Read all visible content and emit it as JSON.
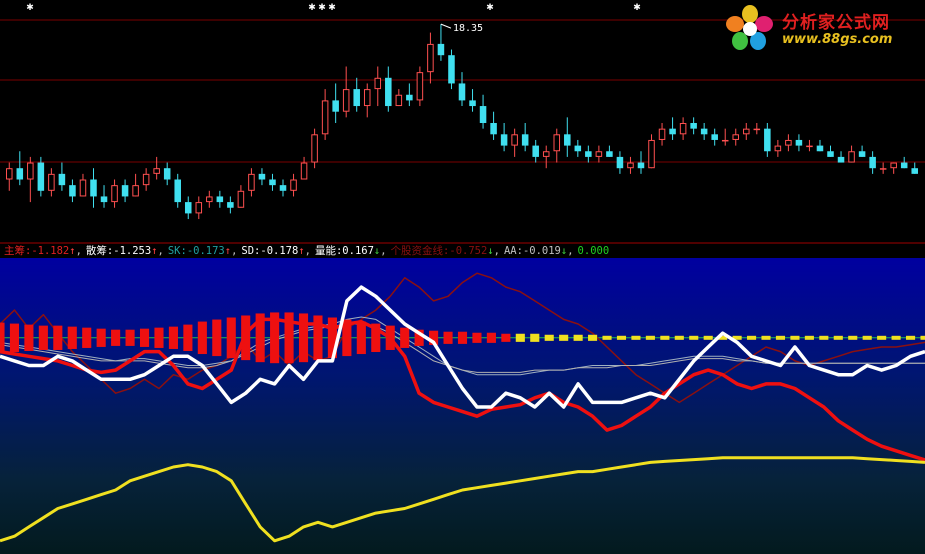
{
  "logo": {
    "title": "分析家公式网",
    "url": "www.88gs.com"
  },
  "indicator_legend": [
    {
      "label": "主筹:",
      "value": "-1.182",
      "arrow": "↑",
      "color": "#e02020"
    },
    {
      "label": "散筹:",
      "value": "-1.253",
      "arrow": "↑",
      "color": "#ffffff"
    },
    {
      "label": "SK:",
      "value": "-0.173",
      "arrow": "↑",
      "color": "#20a0a0"
    },
    {
      "label": "SD:",
      "value": "-0.178",
      "arrow": "↑",
      "color": "#ffffff"
    },
    {
      "label": "量能:",
      "value": "0.167",
      "arrow": "↓",
      "color": "#ffffff"
    },
    {
      "label": "个股资金线:",
      "value": "-0.752",
      "arrow": "↓",
      "color": "#8b1010"
    },
    {
      "label": "AA:",
      "value": "-0.019",
      "arrow": "↓",
      "color": "#c0c0c0"
    },
    {
      "label": "",
      "value": "0.000",
      "arrow": "",
      "color": "#20d020"
    }
  ],
  "colors": {
    "up": "#ff5050",
    "down": "#40e0f0",
    "white": "#ffffff",
    "red": "#ee1010",
    "darkred": "#8b1010",
    "yellow": "#f0e020",
    "sk": "#a0b0c0",
    "sd": "#b0b0b0",
    "zero": "#20c040"
  },
  "chart_data": [
    {
      "type": "candlestick",
      "high_label": "18.35",
      "ohlc": [
        [
          15.6,
          15.9,
          15.4,
          15.8
        ],
        [
          15.8,
          16.1,
          15.5,
          15.6
        ],
        [
          15.6,
          16.0,
          15.2,
          15.9
        ],
        [
          15.9,
          16.0,
          15.3,
          15.4
        ],
        [
          15.4,
          15.8,
          15.3,
          15.7
        ],
        [
          15.7,
          15.9,
          15.4,
          15.5
        ],
        [
          15.5,
          15.6,
          15.2,
          15.3
        ],
        [
          15.3,
          15.7,
          15.3,
          15.6
        ],
        [
          15.6,
          15.8,
          15.1,
          15.3
        ],
        [
          15.3,
          15.5,
          15.1,
          15.2
        ],
        [
          15.2,
          15.6,
          15.1,
          15.5
        ],
        [
          15.5,
          15.6,
          15.2,
          15.3
        ],
        [
          15.3,
          15.7,
          15.3,
          15.5
        ],
        [
          15.5,
          15.8,
          15.4,
          15.7
        ],
        [
          15.7,
          16.0,
          15.6,
          15.8
        ],
        [
          15.8,
          15.9,
          15.5,
          15.6
        ],
        [
          15.6,
          15.7,
          15.1,
          15.2
        ],
        [
          15.2,
          15.3,
          14.9,
          15.0
        ],
        [
          15.0,
          15.3,
          14.9,
          15.2
        ],
        [
          15.2,
          15.4,
          15.1,
          15.3
        ],
        [
          15.3,
          15.4,
          15.1,
          15.2
        ],
        [
          15.2,
          15.3,
          15.0,
          15.1
        ],
        [
          15.1,
          15.5,
          15.1,
          15.4
        ],
        [
          15.4,
          15.8,
          15.3,
          15.7
        ],
        [
          15.7,
          15.8,
          15.5,
          15.6
        ],
        [
          15.6,
          15.7,
          15.4,
          15.5
        ],
        [
          15.5,
          15.6,
          15.3,
          15.4
        ],
        [
          15.4,
          15.7,
          15.3,
          15.6
        ],
        [
          15.6,
          16.0,
          15.6,
          15.9
        ],
        [
          15.9,
          16.5,
          15.8,
          16.4
        ],
        [
          16.4,
          17.2,
          16.3,
          17.0
        ],
        [
          17.0,
          17.3,
          16.6,
          16.8
        ],
        [
          16.8,
          17.6,
          16.7,
          17.2
        ],
        [
          17.2,
          17.4,
          16.8,
          16.9
        ],
        [
          16.9,
          17.3,
          16.7,
          17.2
        ],
        [
          17.2,
          17.6,
          16.9,
          17.4
        ],
        [
          17.4,
          17.6,
          16.8,
          16.9
        ],
        [
          16.9,
          17.2,
          16.9,
          17.1
        ],
        [
          17.1,
          17.3,
          16.9,
          17.0
        ],
        [
          17.0,
          17.6,
          16.9,
          17.5
        ],
        [
          17.5,
          18.2,
          17.3,
          18.0
        ],
        [
          18.0,
          18.35,
          17.7,
          17.8
        ],
        [
          17.8,
          17.9,
          17.2,
          17.3
        ],
        [
          17.3,
          17.5,
          16.9,
          17.0
        ],
        [
          17.0,
          17.2,
          16.8,
          16.9
        ],
        [
          16.9,
          17.1,
          16.5,
          16.6
        ],
        [
          16.6,
          16.8,
          16.3,
          16.4
        ],
        [
          16.4,
          16.6,
          16.1,
          16.2
        ],
        [
          16.2,
          16.5,
          16.0,
          16.4
        ],
        [
          16.4,
          16.6,
          16.1,
          16.2
        ],
        [
          16.2,
          16.3,
          15.9,
          16.0
        ],
        [
          16.0,
          16.2,
          15.8,
          16.1
        ],
        [
          16.1,
          16.5,
          15.9,
          16.4
        ],
        [
          16.4,
          16.7,
          16.0,
          16.2
        ],
        [
          16.2,
          16.3,
          16.0,
          16.1
        ],
        [
          16.1,
          16.2,
          15.9,
          16.0
        ],
        [
          16.0,
          16.2,
          15.9,
          16.1
        ],
        [
          16.1,
          16.2,
          16.0,
          16.0
        ],
        [
          16.0,
          16.1,
          15.7,
          15.8
        ],
        [
          15.8,
          16.0,
          15.7,
          15.9
        ],
        [
          15.9,
          16.1,
          15.7,
          15.8
        ],
        [
          15.8,
          16.4,
          15.8,
          16.3
        ],
        [
          16.3,
          16.6,
          16.2,
          16.5
        ],
        [
          16.5,
          16.7,
          16.3,
          16.4
        ],
        [
          16.4,
          16.7,
          16.3,
          16.6
        ],
        [
          16.6,
          16.7,
          16.4,
          16.5
        ],
        [
          16.5,
          16.6,
          16.3,
          16.4
        ],
        [
          16.4,
          16.5,
          16.2,
          16.3
        ],
        [
          16.3,
          16.5,
          16.2,
          16.3
        ],
        [
          16.3,
          16.5,
          16.2,
          16.4
        ],
        [
          16.4,
          16.6,
          16.3,
          16.5
        ],
        [
          16.5,
          16.6,
          16.4,
          16.5
        ],
        [
          16.5,
          16.6,
          16.0,
          16.1
        ],
        [
          16.1,
          16.3,
          16.0,
          16.2
        ],
        [
          16.2,
          16.4,
          16.1,
          16.3
        ],
        [
          16.3,
          16.4,
          16.1,
          16.2
        ],
        [
          16.2,
          16.3,
          16.1,
          16.2
        ],
        [
          16.2,
          16.3,
          16.1,
          16.1
        ],
        [
          16.1,
          16.2,
          16.0,
          16.0
        ],
        [
          16.0,
          16.1,
          15.9,
          15.9
        ],
        [
          15.9,
          16.2,
          15.9,
          16.1
        ],
        [
          16.1,
          16.2,
          16.0,
          16.0
        ],
        [
          16.0,
          16.1,
          15.7,
          15.8
        ],
        [
          15.8,
          15.9,
          15.7,
          15.8
        ],
        [
          15.8,
          15.9,
          15.7,
          15.9
        ],
        [
          15.9,
          16.0,
          15.8,
          15.8
        ],
        [
          15.8,
          15.9,
          15.7,
          15.7
        ]
      ],
      "ylim": [
        14.6,
        18.6
      ]
    },
    {
      "type": "line",
      "ylim": [
        -4.6,
        1.6
      ],
      "series": [
        {
          "name": "主筹",
          "color": "#ee1010",
          "values": [
            -0.3,
            -0.35,
            -0.4,
            -0.45,
            -0.5,
            -0.6,
            -0.7,
            -0.75,
            -0.7,
            -0.5,
            -0.3,
            -0.3,
            -0.6,
            -1.0,
            -1.1,
            -0.9,
            -0.7,
            0.1,
            0.4,
            0.4,
            0.35,
            0.3,
            0.3,
            0.2,
            0.3,
            0.35,
            0.2,
            0.0,
            -0.4,
            -1.2,
            -1.4,
            -1.5,
            -1.6,
            -1.7,
            -1.55,
            -1.5,
            -1.45,
            -1.3,
            -1.2,
            -1.4,
            -1.5,
            -1.7,
            -2.0,
            -1.9,
            -1.7,
            -1.5,
            -1.2,
            -1.0,
            -0.8,
            -0.7,
            -0.8,
            -1.0,
            -1.1,
            -1.0,
            -1.0,
            -1.1,
            -1.3,
            -1.5,
            -1.8,
            -2.0,
            -2.2,
            -2.35,
            -2.45,
            -2.55,
            -2.65
          ]
        },
        {
          "name": "散筹",
          "color": "#ffffff",
          "values": [
            -0.4,
            -0.5,
            -0.6,
            -0.6,
            -0.4,
            -0.5,
            -0.7,
            -0.9,
            -0.9,
            -0.9,
            -0.8,
            -0.6,
            -0.4,
            -0.4,
            -0.6,
            -1.0,
            -1.4,
            -1.2,
            -0.9,
            -1.0,
            -0.6,
            -0.9,
            -0.5,
            -0.5,
            0.8,
            1.1,
            0.9,
            0.6,
            0.3,
            0.1,
            -0.1,
            -0.6,
            -1.1,
            -1.5,
            -1.5,
            -1.2,
            -1.3,
            -1.5,
            -1.2,
            -1.5,
            -1.0,
            -1.4,
            -1.4,
            -1.4,
            -1.3,
            -1.2,
            -1.3,
            -0.9,
            -0.5,
            -0.2,
            0.1,
            -0.1,
            -0.4,
            -0.5,
            -0.6,
            -0.2,
            -0.6,
            -0.7,
            -0.8,
            -0.8,
            -0.6,
            -0.7,
            -0.6,
            -0.4,
            -0.3
          ]
        },
        {
          "name": "SK",
          "color": "#a0b0c0",
          "values": [
            -0.1,
            -0.15,
            -0.2,
            -0.25,
            -0.3,
            -0.35,
            -0.4,
            -0.45,
            -0.5,
            -0.45,
            -0.45,
            -0.5,
            -0.55,
            -0.6,
            -0.6,
            -0.55,
            -0.5,
            -0.3,
            -0.1,
            0.0,
            0.1,
            0.2,
            0.25,
            0.3,
            0.4,
            0.45,
            0.4,
            0.2,
            0.0,
            -0.2,
            -0.4,
            -0.6,
            -0.7,
            -0.8,
            -0.8,
            -0.8,
            -0.8,
            -0.75,
            -0.7,
            -0.7,
            -0.65,
            -0.6,
            -0.6,
            -0.6,
            -0.6,
            -0.55,
            -0.5,
            -0.45,
            -0.4,
            -0.4,
            -0.4,
            -0.45,
            -0.5,
            -0.55,
            -0.55,
            -0.55,
            -0.55,
            -0.55,
            -0.55,
            -0.55,
            -0.55,
            -0.55,
            -0.55,
            -0.55,
            -0.55
          ]
        },
        {
          "name": "SD",
          "color": "#b0b0b0",
          "values": [
            -0.15,
            -0.2,
            -0.25,
            -0.3,
            -0.35,
            -0.4,
            -0.45,
            -0.5,
            -0.5,
            -0.5,
            -0.5,
            -0.55,
            -0.6,
            -0.65,
            -0.65,
            -0.6,
            -0.5,
            -0.35,
            -0.2,
            -0.05,
            0.05,
            0.15,
            0.2,
            0.25,
            0.3,
            0.3,
            0.25,
            0.1,
            -0.1,
            -0.3,
            -0.5,
            -0.6,
            -0.7,
            -0.75,
            -0.75,
            -0.75,
            -0.75,
            -0.7,
            -0.7,
            -0.7,
            -0.65,
            -0.65,
            -0.65,
            -0.6,
            -0.6,
            -0.6,
            -0.55,
            -0.5,
            -0.45,
            -0.45,
            -0.45,
            -0.5,
            -0.5,
            -0.55,
            -0.55,
            -0.55,
            -0.55,
            -0.55,
            -0.55,
            -0.55,
            -0.55,
            -0.55,
            -0.55,
            -0.55,
            -0.55
          ]
        },
        {
          "name": "量能",
          "color": "#f0e020",
          "values": [
            -4.4,
            -4.3,
            -4.1,
            -3.9,
            -3.7,
            -3.6,
            -3.5,
            -3.4,
            -3.3,
            -3.1,
            -3.0,
            -2.9,
            -2.8,
            -2.75,
            -2.8,
            -2.9,
            -3.1,
            -3.6,
            -4.1,
            -4.4,
            -4.3,
            -4.1,
            -4.0,
            -4.1,
            -4.0,
            -3.9,
            -3.8,
            -3.75,
            -3.7,
            -3.6,
            -3.5,
            -3.4,
            -3.3,
            -3.25,
            -3.2,
            -3.15,
            -3.1,
            -3.05,
            -3.0,
            -2.95,
            -2.9,
            -2.9,
            -2.85,
            -2.8,
            -2.75,
            -2.7,
            -2.68,
            -2.66,
            -2.64,
            -2.62,
            -2.6,
            -2.6,
            -2.6,
            -2.6,
            -2.6,
            -2.6,
            -2.6,
            -2.6,
            -2.6,
            -2.6,
            -2.62,
            -2.64,
            -2.66,
            -2.68,
            -2.7
          ]
        },
        {
          "name": "个股资金线",
          "color": "#8b1010",
          "values": [
            0.3,
            0.6,
            0.2,
            0.5,
            0.1,
            -0.3,
            -0.6,
            -0.9,
            -1.2,
            -1.1,
            -0.9,
            -1.1,
            -0.8,
            -0.9,
            -0.7,
            -0.6,
            -0.4,
            -0.1,
            -0.5,
            -0.3,
            -0.6,
            -0.3,
            -0.5,
            -0.4,
            0.2,
            0.4,
            0.6,
            0.9,
            1.3,
            1.1,
            0.8,
            0.9,
            1.2,
            1.4,
            1.3,
            1.1,
            1.0,
            0.8,
            0.6,
            0.4,
            0.3,
            0.1,
            -0.2,
            -0.5,
            -0.8,
            -1.0,
            -1.2,
            -1.4,
            -1.2,
            -1.0,
            -0.8,
            -0.6,
            -0.4,
            -0.2,
            -0.3,
            -0.5,
            -0.6,
            -0.5,
            -0.4,
            -0.3,
            -0.25,
            -0.2,
            -0.2,
            -0.15,
            -0.1
          ]
        },
        {
          "name": "AA",
          "color": "#ee1010",
          "style": "bars",
          "values": [
            0.15,
            0.14,
            0.13,
            0.12,
            0.12,
            0.11,
            0.1,
            0.09,
            0.08,
            0.08,
            0.09,
            0.1,
            0.11,
            0.13,
            0.16,
            0.18,
            0.2,
            0.22,
            0.24,
            0.25,
            0.25,
            0.24,
            0.22,
            0.2,
            0.18,
            0.16,
            0.14,
            0.12,
            0.1,
            0.08,
            0.07,
            0.06,
            0.06,
            0.05,
            0.05,
            0.04,
            0.04,
            0.04,
            0.03,
            0.03,
            0.03,
            0.03,
            0.02,
            0.02,
            0.02,
            0.02,
            0.02,
            0.02,
            0.01,
            0.01,
            0.01,
            0.01,
            0.01,
            0.01,
            0.01,
            0.01,
            0.01,
            0.01,
            0.01,
            0.0,
            0.0,
            0.0,
            0.0,
            0.0,
            0.0
          ]
        }
      ]
    }
  ]
}
